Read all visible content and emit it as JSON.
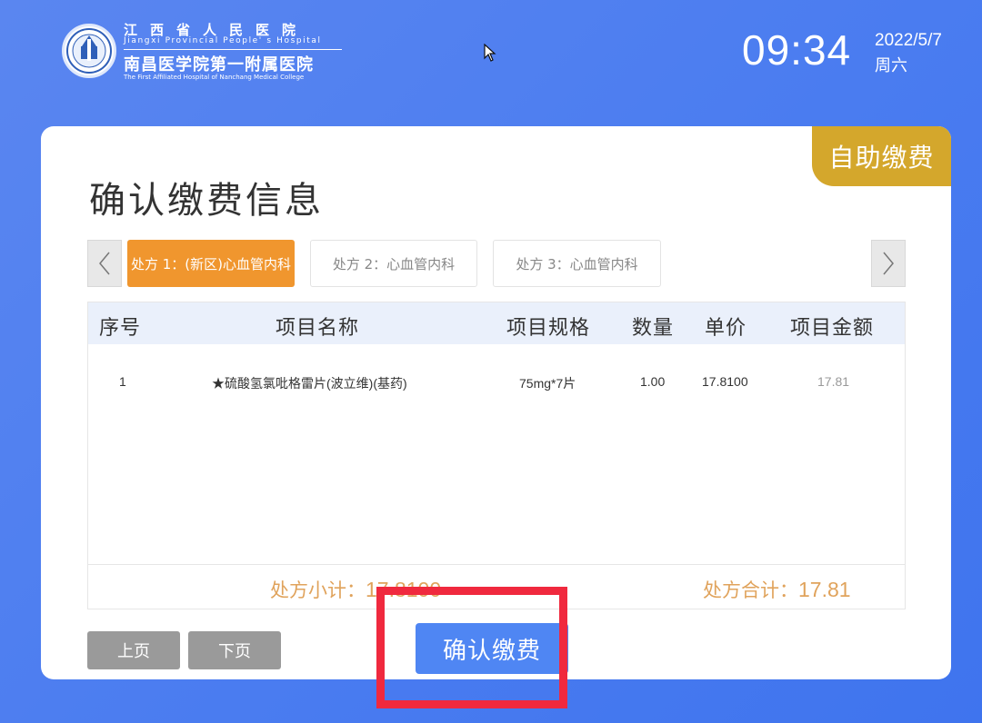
{
  "header": {
    "hospital_cn_top": "江西省人民医院",
    "hospital_en_top": "Jiangxi Provincial People' s Hospital",
    "hospital_cn_main": "南昌医学院第一附属医院",
    "hospital_en_main": "The First Affiliated Hospital of Nanchang Medical College",
    "time": "09:34",
    "date": "2022/5/7",
    "weekday": "周六"
  },
  "badge": {
    "label": "自助缴费"
  },
  "page": {
    "title": "确认缴费信息"
  },
  "tabs": [
    {
      "label": "处方 1：(新区)心血管内科",
      "active": true
    },
    {
      "label": "处方 2：心血管内科",
      "active": false
    },
    {
      "label": "处方 3：心血管内科",
      "active": false
    }
  ],
  "table": {
    "headers": [
      "序号",
      "项目名称",
      "项目规格",
      "数量",
      "单价",
      "项目金额"
    ],
    "rows": [
      {
        "index": "1",
        "name": "★硫酸氢氯吡格雷片(波立维)(基药)",
        "spec": "75mg*7片",
        "qty": "1.00",
        "unit_price": "17.8100",
        "amount": "17.81"
      }
    ],
    "subtotal_label": "处方小计：",
    "subtotal_value": "17.8100",
    "total_label": "处方合计：",
    "total_value": "17.81"
  },
  "buttons": {
    "prev_page": "上页",
    "next_page": "下页",
    "confirm": "确认缴费"
  },
  "colors": {
    "background": "#4a7cf0",
    "badge": "#d4a72c",
    "active_tab": "#f0962e",
    "confirm_button": "#4f86f3",
    "total_text": "#e0a35c",
    "highlight": "#f0293e"
  }
}
